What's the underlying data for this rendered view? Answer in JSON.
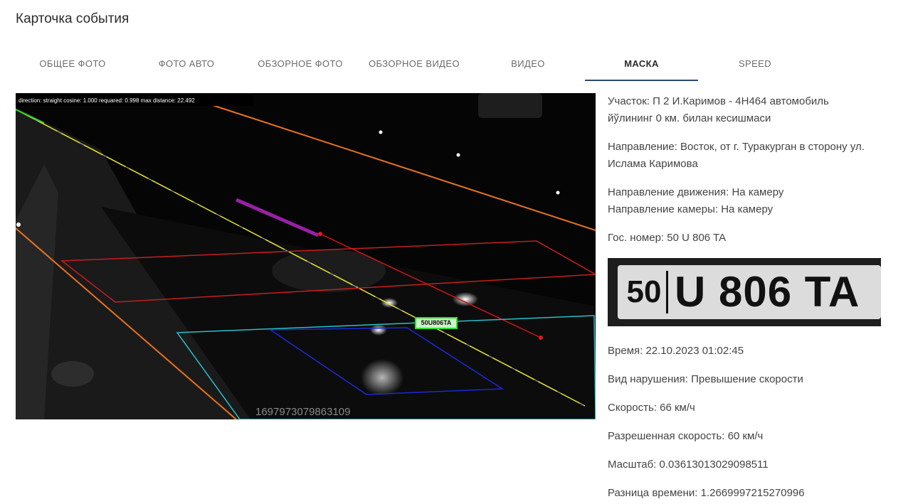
{
  "page": {
    "title": "Карточка события"
  },
  "tabs": [
    {
      "label": "ОБЩЕЕ ФОТО",
      "active": false
    },
    {
      "label": "ФОТО АВТО",
      "active": false
    },
    {
      "label": "ОБЗОРНОЕ ФОТО",
      "active": false
    },
    {
      "label": "ОБЗОРНОЕ ВИДЕО",
      "active": false
    },
    {
      "label": "ВИДЕО",
      "active": false
    },
    {
      "label": "МАСКА",
      "active": true
    },
    {
      "label": "SPEED",
      "active": false
    }
  ],
  "media": {
    "overlay_text": "direction: straight   cosine: 1.000   requared: 0.998   max distance: 22.492",
    "timestamp": "1697973079863109",
    "plate_tag": "50U806TA"
  },
  "info": {
    "section_line1": "Участок: П 2 И.Каримов - 4Н464 автомобиль",
    "section_line2": "йўлининг 0 км. билан кесишмаси",
    "direction_line1": "Направление: Восток, от г. Туракурган в сторону ул.",
    "direction_line2": "Ислама Каримова",
    "movement_direction": "Направление движения: На камеру",
    "camera_direction": "Направление камеры: На камеру",
    "plate_number": "Гос. номер: 50 U 806 TA",
    "time": "Время: 22.10.2023 01:02:45",
    "violation_type": "Вид нарушения: Превышение скорости",
    "speed": "Скорость: 66 км/ч",
    "allowed_speed": "Разрешенная скорость: 60 км/ч",
    "scale": "Масштаб: 0.03613013029098511",
    "time_difference": "Разница времени: 1.2669997215270996"
  },
  "plate_image": {
    "region": "50",
    "number": "U 806 TA"
  },
  "colors": {
    "active_tab_underline": "#2c4a6e"
  }
}
